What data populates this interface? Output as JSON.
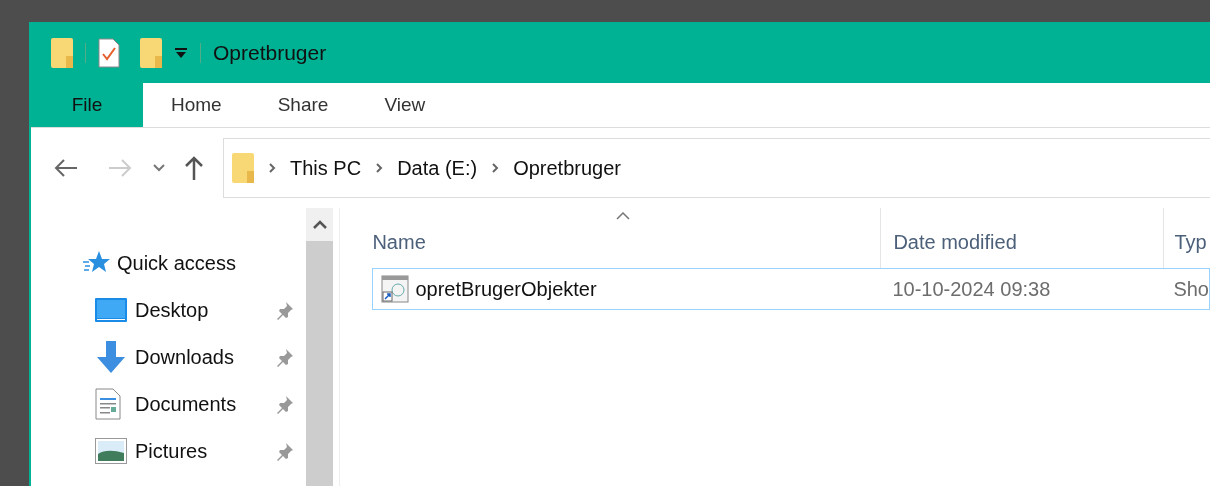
{
  "window": {
    "title": "Opretbruger"
  },
  "ribbon_tabs": [
    {
      "label": "File",
      "selected": true
    },
    {
      "label": "Home",
      "selected": false
    },
    {
      "label": "Share",
      "selected": false
    },
    {
      "label": "View",
      "selected": false
    }
  ],
  "breadcrumb": [
    "This PC",
    "Data (E:)",
    "Opretbruger"
  ],
  "sidebar": {
    "quick_access": "Quick access",
    "items": [
      {
        "label": "Desktop",
        "kind": "desktop",
        "pinned": true
      },
      {
        "label": "Downloads",
        "kind": "downloads",
        "pinned": true
      },
      {
        "label": "Documents",
        "kind": "documents",
        "pinned": true
      },
      {
        "label": "Pictures",
        "kind": "pictures",
        "pinned": true
      }
    ]
  },
  "table": {
    "columns": [
      "Name",
      "Date modified",
      "Typ"
    ],
    "rows": [
      {
        "name": "opretBrugerObjekter",
        "date": "10-10-2024 09:38",
        "type": "Sho",
        "selected": true
      }
    ]
  }
}
